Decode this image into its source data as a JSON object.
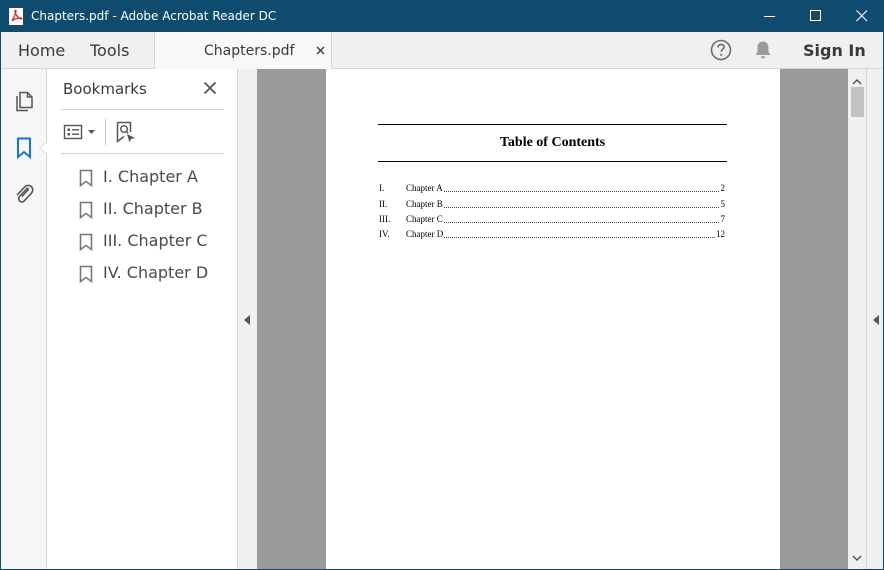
{
  "window": {
    "title": "Chapters.pdf - Adobe Acrobat Reader DC"
  },
  "nav": {
    "home": "Home",
    "tools": "Tools",
    "document_tab": "Chapters.pdf",
    "sign_in": "Sign In"
  },
  "bookmarks_panel": {
    "title": "Bookmarks",
    "items": [
      {
        "label": "I. Chapter A"
      },
      {
        "label": "II. Chapter B"
      },
      {
        "label": "III. Chapter C"
      },
      {
        "label": "IV. Chapter D"
      }
    ]
  },
  "document": {
    "heading": "Table of Contents",
    "entries": [
      {
        "num": "I.",
        "title": "Chapter A",
        "page": "2"
      },
      {
        "num": "II.",
        "title": "Chapter B",
        "page": "5"
      },
      {
        "num": "III.",
        "title": "Chapter C",
        "page": "7"
      },
      {
        "num": "IV.",
        "title": "Chapter D",
        "page": "12"
      }
    ]
  },
  "colors": {
    "titlebar": "#0e4b6f",
    "accent": "#1473e6",
    "document_background": "#9a9a9a"
  },
  "icons": {
    "app": "acrobat-pdf-icon",
    "help": "help-icon",
    "notifications": "bell-icon",
    "rail": [
      "page-thumbnails-icon",
      "bookmark-icon",
      "attachment-icon"
    ],
    "panel_tools": [
      "options-list-icon",
      "find-bookmark-icon"
    ]
  }
}
